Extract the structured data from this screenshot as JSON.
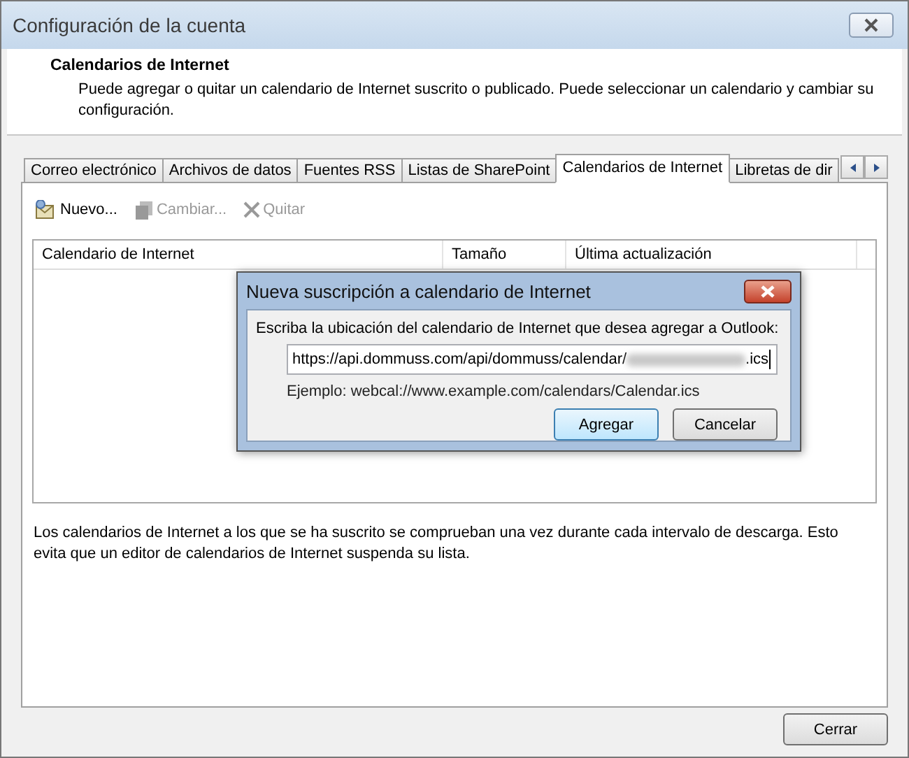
{
  "window": {
    "title": "Configuración de la cuenta"
  },
  "header": {
    "title": "Calendarios de Internet",
    "description": "Puede agregar o quitar un calendario de Internet suscrito o publicado. Puede seleccionar un calendario y cambiar su configuración."
  },
  "tabs": [
    {
      "label": "Correo electrónico",
      "selected": false
    },
    {
      "label": "Archivos de datos",
      "selected": false
    },
    {
      "label": "Fuentes RSS",
      "selected": false
    },
    {
      "label": "Listas de SharePoint",
      "selected": false
    },
    {
      "label": "Calendarios de Internet",
      "selected": true
    },
    {
      "label": "Libretas de dir",
      "selected": false
    }
  ],
  "toolbar": [
    {
      "kind": "new",
      "label": "Nuevo...",
      "disabled": false
    },
    {
      "kind": "change",
      "label": "Cambiar...",
      "disabled": true
    },
    {
      "kind": "remove",
      "label": "Quitar",
      "disabled": true
    }
  ],
  "table": {
    "columns": [
      "Calendario de Internet",
      "Tamaño",
      "Última actualización"
    ]
  },
  "note": "Los calendarios de Internet a los que se ha suscrito se comprueban una vez durante cada intervalo de descarga. Esto evita que un editor de calendarios de Internet suspenda su lista.",
  "dialog": {
    "title": "Nueva suscripción a calendario de Internet",
    "prompt": "Escriba la ubicación del calendario de Internet que desea agregar a Outlook:",
    "value_start": "https://api.dommuss.com/api/dommuss/calendar/",
    "value_end": ".ics",
    "example": "Ejemplo: webcal://www.example.com/calendars/Calendar.ics",
    "buttons": [
      {
        "label": "Agregar",
        "default": true
      },
      {
        "label": "Cancelar",
        "default": false
      }
    ]
  },
  "buttons": [
    "Cerrar"
  ]
}
